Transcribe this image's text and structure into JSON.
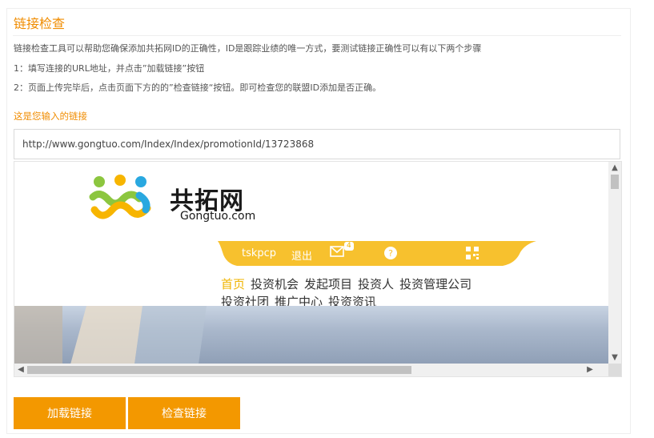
{
  "title": "链接检查",
  "description": {
    "line1": "链接检查工具可以帮助您确保添加共拓网ID的正确性，ID是跟踪业绩的唯一方式，要测试链接正确性可以有以下两个步骤",
    "line2": "1：填写连接的URL地址，并点击”加载链接”按钮",
    "line3": "2：页面上传完毕后，点击页面下方的的”检查链接“按钮。即可检查您的联盟ID添加是否正确。"
  },
  "input_label": "这是您输入的链接",
  "url_input": {
    "value": "http://www.gongtuo.com/Index/Index/promotionId/13723868"
  },
  "preview": {
    "logo_cn": "共拓网",
    "logo_en": "Gongtuo.com",
    "user_bar": {
      "username": "tskpcp",
      "logout": "退出",
      "mail_badge": "4",
      "mail_icon": "envelope-icon",
      "help_icon": "question-icon",
      "qr_icon": "qrcode-icon",
      "color": "#f7c12e"
    },
    "nav_row1": [
      "首页",
      "投资机会",
      "发起项目",
      "投资人",
      "投资管理公司"
    ],
    "nav_row2": [
      "投资社团",
      "推广中心",
      "投资资讯"
    ]
  },
  "buttons": {
    "load": "加载链接",
    "check": "检查链接"
  },
  "colors": {
    "accent": "#f39800",
    "title": "#f08c00"
  }
}
